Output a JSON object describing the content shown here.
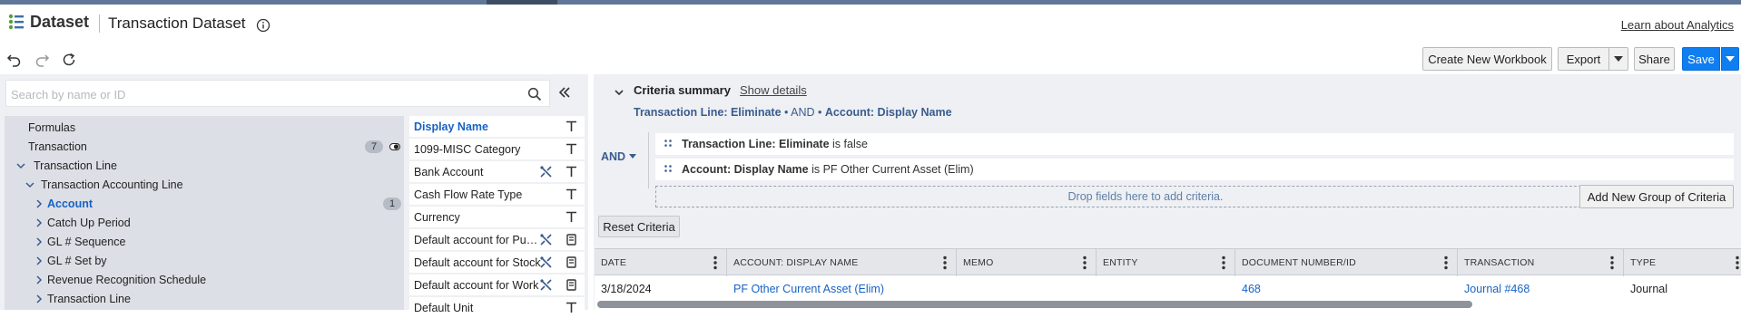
{
  "app": {
    "brand": "Dataset",
    "title": "Transaction Dataset",
    "learn_link": "Learn about Analytics"
  },
  "toolbar": {
    "icons": [
      "undo-icon",
      "redo-icon",
      "refresh-icon"
    ],
    "create_workbook": "Create New Workbook",
    "export": "Export",
    "share": "Share",
    "save": "Save"
  },
  "left": {
    "search_placeholder": "Search by name or ID",
    "tree": [
      {
        "label": "Formulas"
      },
      {
        "label": "Transaction",
        "badge": "7"
      },
      {
        "label": "Transaction Line"
      },
      {
        "label": "Transaction Accounting Line"
      },
      {
        "label": "Account",
        "badge": "1"
      },
      {
        "label": "Catch Up Period"
      },
      {
        "label": "GL # Sequence"
      },
      {
        "label": "GL # Set by"
      },
      {
        "label": "Revenue Recognition Schedule"
      },
      {
        "label": "Transaction Line"
      }
    ],
    "fields": [
      {
        "label": "Display Name",
        "icon": "text-type-icon"
      },
      {
        "label": "1099-MISC Category",
        "icon": "text-type-icon"
      },
      {
        "label": "Bank Account",
        "icon": "text-type-icon"
      },
      {
        "label": "Cash Flow Rate Type",
        "icon": "text-type-icon"
      },
      {
        "label": "Currency",
        "icon": "text-type-icon"
      },
      {
        "label": "Default account for Purchases",
        "icon": "record-type-icon"
      },
      {
        "label": "Default account for Stock",
        "icon": "record-type-icon"
      },
      {
        "label": "Default account for Work",
        "icon": "record-type-icon"
      },
      {
        "label": "Default Unit",
        "icon": "text-type-icon"
      }
    ]
  },
  "criteria": {
    "title": "Criteria summary",
    "show_details": "Show details",
    "summary": {
      "part1": "Transaction Line: Eliminate",
      "join": " • AND • ",
      "part2": "Account: Display Name"
    },
    "operator": "AND",
    "conditions": [
      {
        "field": "Transaction Line: Eliminate",
        "rest": " is false"
      },
      {
        "field": "Account: Display Name",
        "rest": " is PF Other Current Asset (Elim)"
      }
    ],
    "drop_hint": "Drop fields here to add criteria.",
    "add_group": "Add New Group of Criteria",
    "reset": "Reset Criteria"
  },
  "grid": {
    "columns": [
      "DATE",
      "ACCOUNT: DISPLAY NAME",
      "MEMO",
      "ENTITY",
      "DOCUMENT NUMBER/ID",
      "TRANSACTION",
      "TYPE"
    ],
    "rows": [
      [
        "3/18/2024",
        "PF Other Current Asset (Elim)",
        "",
        "",
        "468",
        "Journal #468",
        "Journal"
      ]
    ]
  },
  "colors": {
    "accent": "#0f7ef0",
    "link": "#1763c4",
    "criteria_text": "#3a5b8f"
  }
}
